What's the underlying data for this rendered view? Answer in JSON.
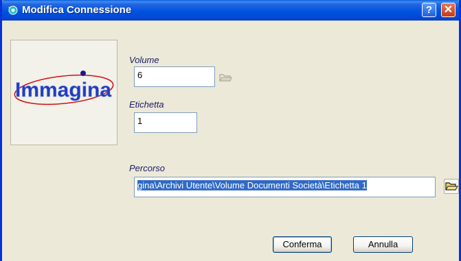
{
  "window": {
    "title": "Modifica Connessione"
  },
  "titlebar": {
    "help_glyph": "?",
    "close_glyph": "✕"
  },
  "logo": {
    "text": "Immagina"
  },
  "fields": {
    "volume": {
      "label": "Volume",
      "value": "6"
    },
    "etichetta": {
      "label": "Etichetta",
      "value": "1"
    },
    "percorso": {
      "label": "Percorso",
      "value": "gina\\Archivi Utente\\Volume Documenti Società\\Etichetta 1"
    }
  },
  "buttons": {
    "confirm_label": "Conferma",
    "cancel_label": "Annulla"
  },
  "icons": {
    "title": "app-icon",
    "volume_browse": "folder-open-icon",
    "path_browse": "folder-open-icon"
  },
  "colors": {
    "title_bar": "#0053e1",
    "window_bg": "#ece9d8",
    "selection": "#316ac5",
    "logo_text": "#1f3fbf",
    "logo_ring": "#d01010"
  }
}
